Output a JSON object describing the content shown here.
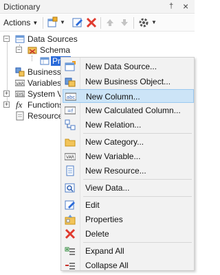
{
  "panel": {
    "title": "Dictionary",
    "pin_glyph": "†",
    "close_glyph": "×"
  },
  "toolbar": {
    "actions_label": "Actions",
    "actions_caret": "▼",
    "new_caret": "▼",
    "settings_caret": "▼",
    "icons": [
      "new-item-icon",
      "edit-icon",
      "delete-icon",
      "move-up-icon",
      "move-down-icon",
      "settings-icon"
    ]
  },
  "tree": {
    "data_sources": "Data Sources",
    "schema": "Schema",
    "product_partial": "Prod",
    "business_objects_partial": "Business O",
    "variables": "Variables",
    "system_variables_partial": "System Va",
    "functions": "Functions",
    "resources_partial": "Resources",
    "expander_minus": "−",
    "expander_plus": "+",
    "fx_glyph": "fx"
  },
  "context_menu": {
    "items": [
      {
        "label": "New Data Source...",
        "icon": "new-data-source-icon"
      },
      {
        "label": "New Business Object...",
        "icon": "new-business-object-icon"
      },
      {
        "label": "New Column...",
        "icon": "new-column-icon"
      },
      {
        "label": "New Calculated Column...",
        "icon": "new-calculated-column-icon"
      },
      {
        "label": "New Relation...",
        "icon": "new-relation-icon"
      },
      {
        "label": "New Category...",
        "icon": "folder-icon"
      },
      {
        "label": "New Variable...",
        "icon": "new-variable-icon"
      },
      {
        "label": "New Resource...",
        "icon": "new-resource-icon"
      },
      {
        "label": "View Data...",
        "icon": "view-data-icon"
      },
      {
        "label": "Edit",
        "icon": "edit-icon"
      },
      {
        "label": "Properties",
        "icon": "properties-icon"
      },
      {
        "label": "Delete",
        "icon": "delete-icon"
      },
      {
        "label": "Expand All",
        "icon": "expand-all-icon"
      },
      {
        "label": "Collapse All",
        "icon": "collapse-all-icon"
      }
    ],
    "hovered_item": "New Column..."
  },
  "colors": {
    "selection": "#2a6ad9",
    "menu_hover": "#cce4f7",
    "delete_red": "#e03a2e"
  }
}
